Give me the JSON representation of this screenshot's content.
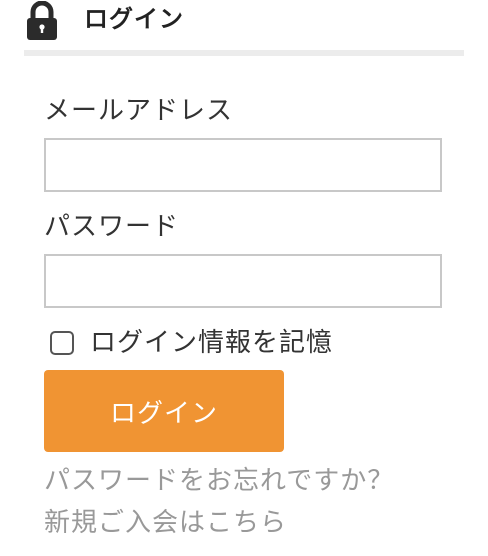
{
  "header": {
    "title": "ログイン",
    "icon": "lock-icon"
  },
  "form": {
    "email_label": "メールアドレス",
    "email_value": "",
    "email_placeholder": "",
    "password_label": "パスワード",
    "password_value": "",
    "password_placeholder": "",
    "remember_label": "ログイン情報を記憶",
    "remember_checked": false,
    "submit_label": "ログイン"
  },
  "links": {
    "forgot_password": "パスワードをお忘れですか？",
    "register": "新規ご入会はこちら"
  },
  "colors": {
    "accent": "#f09433",
    "link": "#999999",
    "divider": "#ececec"
  }
}
